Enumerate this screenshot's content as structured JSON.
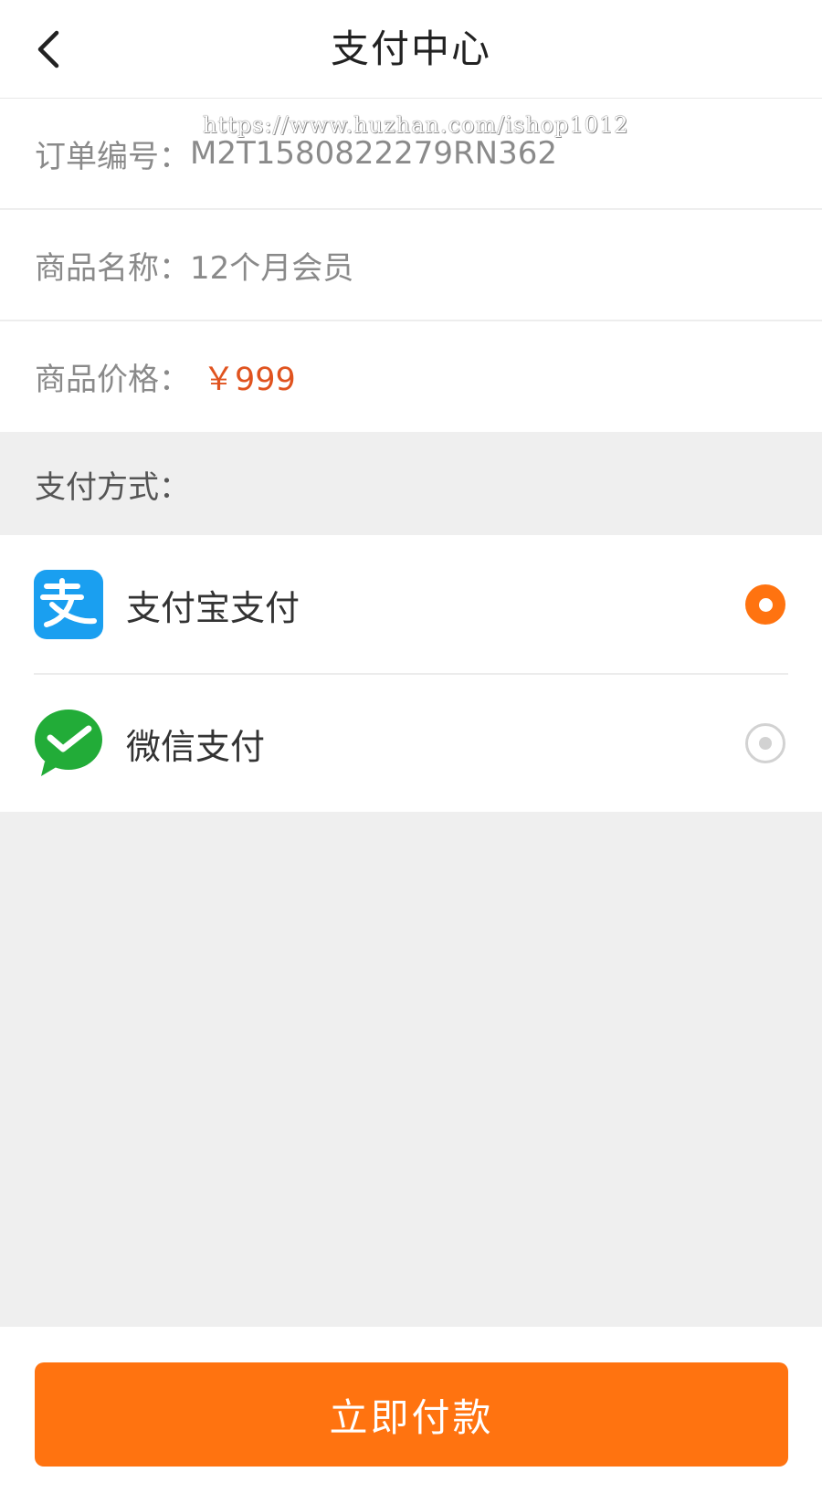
{
  "header": {
    "title": "支付中心",
    "back_icon": "chevron-left-icon"
  },
  "watermark": "https://www.huzhan.com/ishop1012",
  "order": {
    "number_label": "订单编号：",
    "number_value": "M2T1580822279RN362",
    "name_label": "商品名称：",
    "name_value": "12个月会员",
    "price_label": "商品价格：",
    "price_value": "￥999",
    "price_color": "#e0531f"
  },
  "payment": {
    "section_label": "支付方式：",
    "methods": [
      {
        "label": "支付宝支付",
        "icon": "alipay-icon",
        "selected": true,
        "brand_color": "#1a9ff0"
      },
      {
        "label": "微信支付",
        "icon": "wechat-pay-icon",
        "selected": false,
        "brand_color": "#22ac38"
      }
    ]
  },
  "footer": {
    "pay_button_label": "立即付款",
    "accent_color": "#ff7310"
  }
}
